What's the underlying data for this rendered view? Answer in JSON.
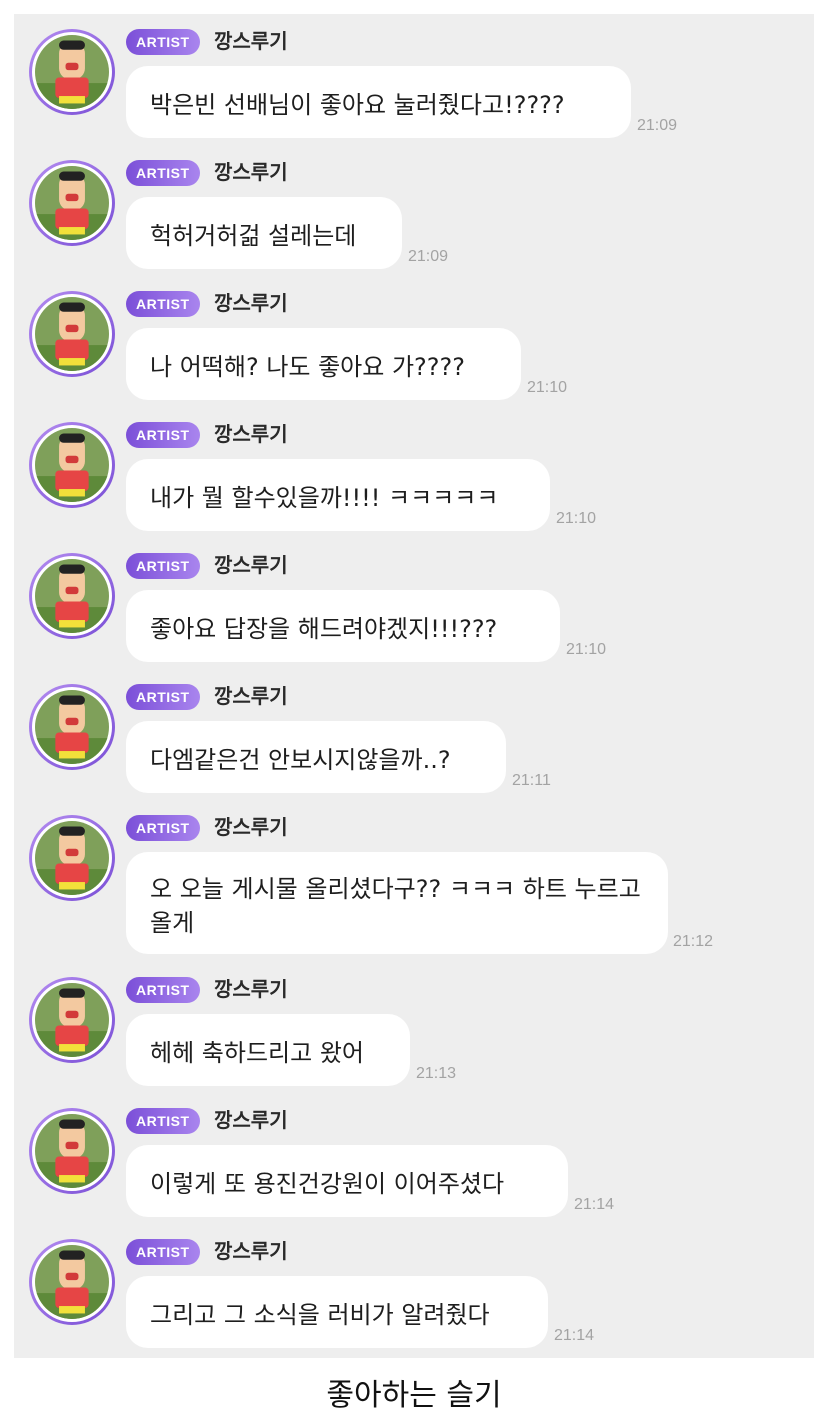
{
  "badge_label": "ARTIST",
  "author_name": "깡스루기",
  "messages": [
    {
      "text": "박은빈 선배님이 좋아요 눌러줬다고!????",
      "time": "21:09"
    },
    {
      "text": "헉허거허걺 설레는데",
      "time": "21:09"
    },
    {
      "text": "나 어떡해? 나도 좋아요 가????",
      "time": "21:10"
    },
    {
      "text": "내가 뭘 할수있을까!!!! ㅋㅋㅋㅋㅋ",
      "time": "21:10"
    },
    {
      "text": " 좋아요 답장을 해드려야겠지!!!???",
      "time": "21:10"
    },
    {
      "text": "다엠같은건 안보시지않을까..?",
      "time": "21:11"
    },
    {
      "text": "오 오늘 게시물 올리셨다구?? ㅋㅋㅋ 하트 누르고 올게",
      "time": "21:12"
    },
    {
      "text": "헤헤 축하드리고 왔어",
      "time": "21:13"
    },
    {
      "text": "이렇게 또 용진건강원이 이어주셨다",
      "time": "21:14"
    },
    {
      "text": "그리고 그 소식을 러비가 알려줬다",
      "time": "21:14"
    }
  ],
  "caption": "좋아하는 슬기",
  "colors": {
    "panel_bg": "#eeeeee",
    "bubble_bg": "#ffffff",
    "badge_gradient_start": "#7b4fd8",
    "badge_gradient_end": "#a985ee",
    "timestamp": "#a3a3a3"
  },
  "icons": {
    "avatar": "cartoon-character-avatar"
  }
}
